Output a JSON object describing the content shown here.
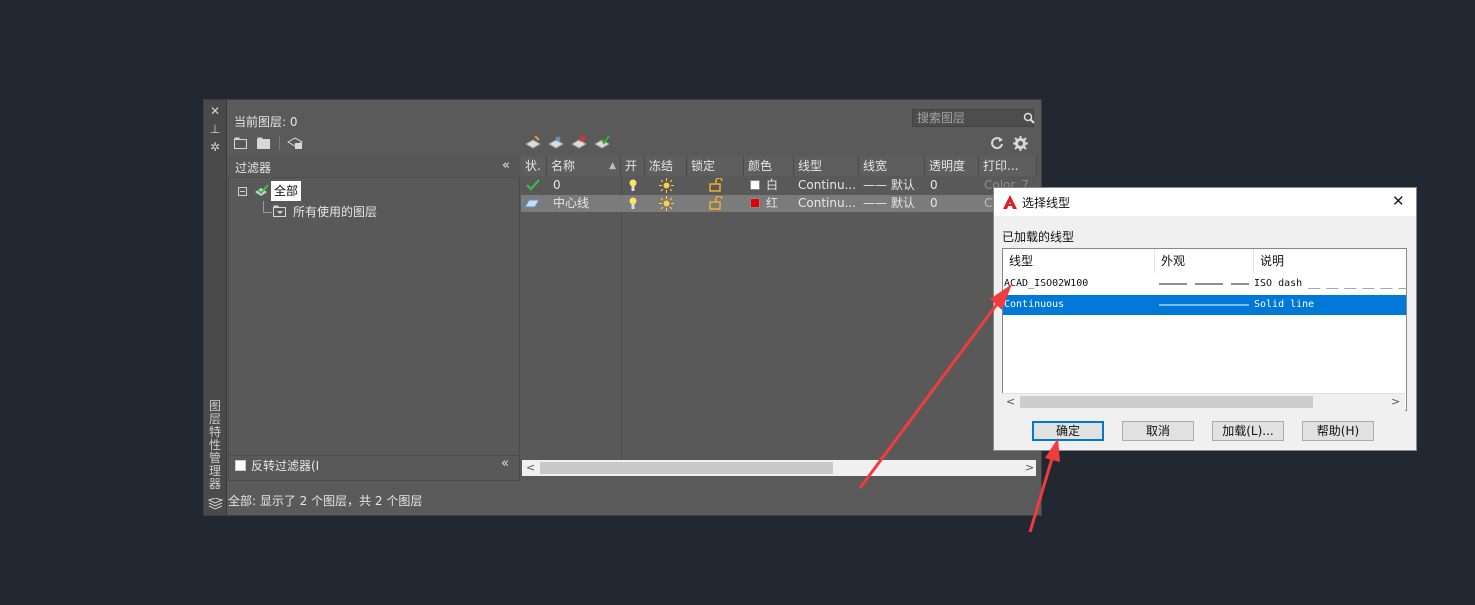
{
  "layer_manager": {
    "vertical_title": "图层特性管理器",
    "current_layer": "当前图层: 0",
    "search_placeholder": "搜索图层",
    "filter_header": "过滤器",
    "filter_tree": {
      "root": "全部",
      "child": "所有使用的图层"
    },
    "invert_filter": "反转过滤器(I",
    "columns": [
      "状.",
      "名称",
      "开",
      "冻结",
      "锁定",
      "颜色",
      "线型",
      "线宽",
      "透明度",
      "打印..."
    ],
    "layers": [
      {
        "status": "check",
        "name": "0",
        "color_name": "白",
        "color_hex": "#ffffff",
        "linetype": "Continu...",
        "lineweight": "—— 默认",
        "transparency": "0",
        "plot_style": "Color_7"
      },
      {
        "status": "layer",
        "name": "中心线",
        "color_name": "红",
        "color_hex": "#e00000",
        "linetype": "Continu...",
        "lineweight": "—— 默认",
        "transparency": "0",
        "plot_style": "Co"
      }
    ],
    "status_text": "全部: 显示了 2 个图层，共 2 个图层"
  },
  "dialog": {
    "title": "选择线型",
    "group_label": "已加载的线型",
    "columns": [
      "线型",
      "外观",
      "说明"
    ],
    "rows": [
      {
        "linetype": "ACAD_ISO02W100",
        "appearance": "dash",
        "description": "ISO dash __ __ __ __ __ __",
        "selected": false
      },
      {
        "linetype": "Continuous",
        "appearance": "solid",
        "description": "Solid line",
        "selected": true
      }
    ],
    "buttons": {
      "ok": "确定",
      "cancel": "取消",
      "load": "加载(L)...",
      "help": "帮助(H)"
    }
  },
  "colors": {
    "accent_selection": "#0078d7",
    "arrow": "#f03c3c",
    "panel_bg": "#5a5a5a",
    "desktop_bg": "#222831"
  }
}
